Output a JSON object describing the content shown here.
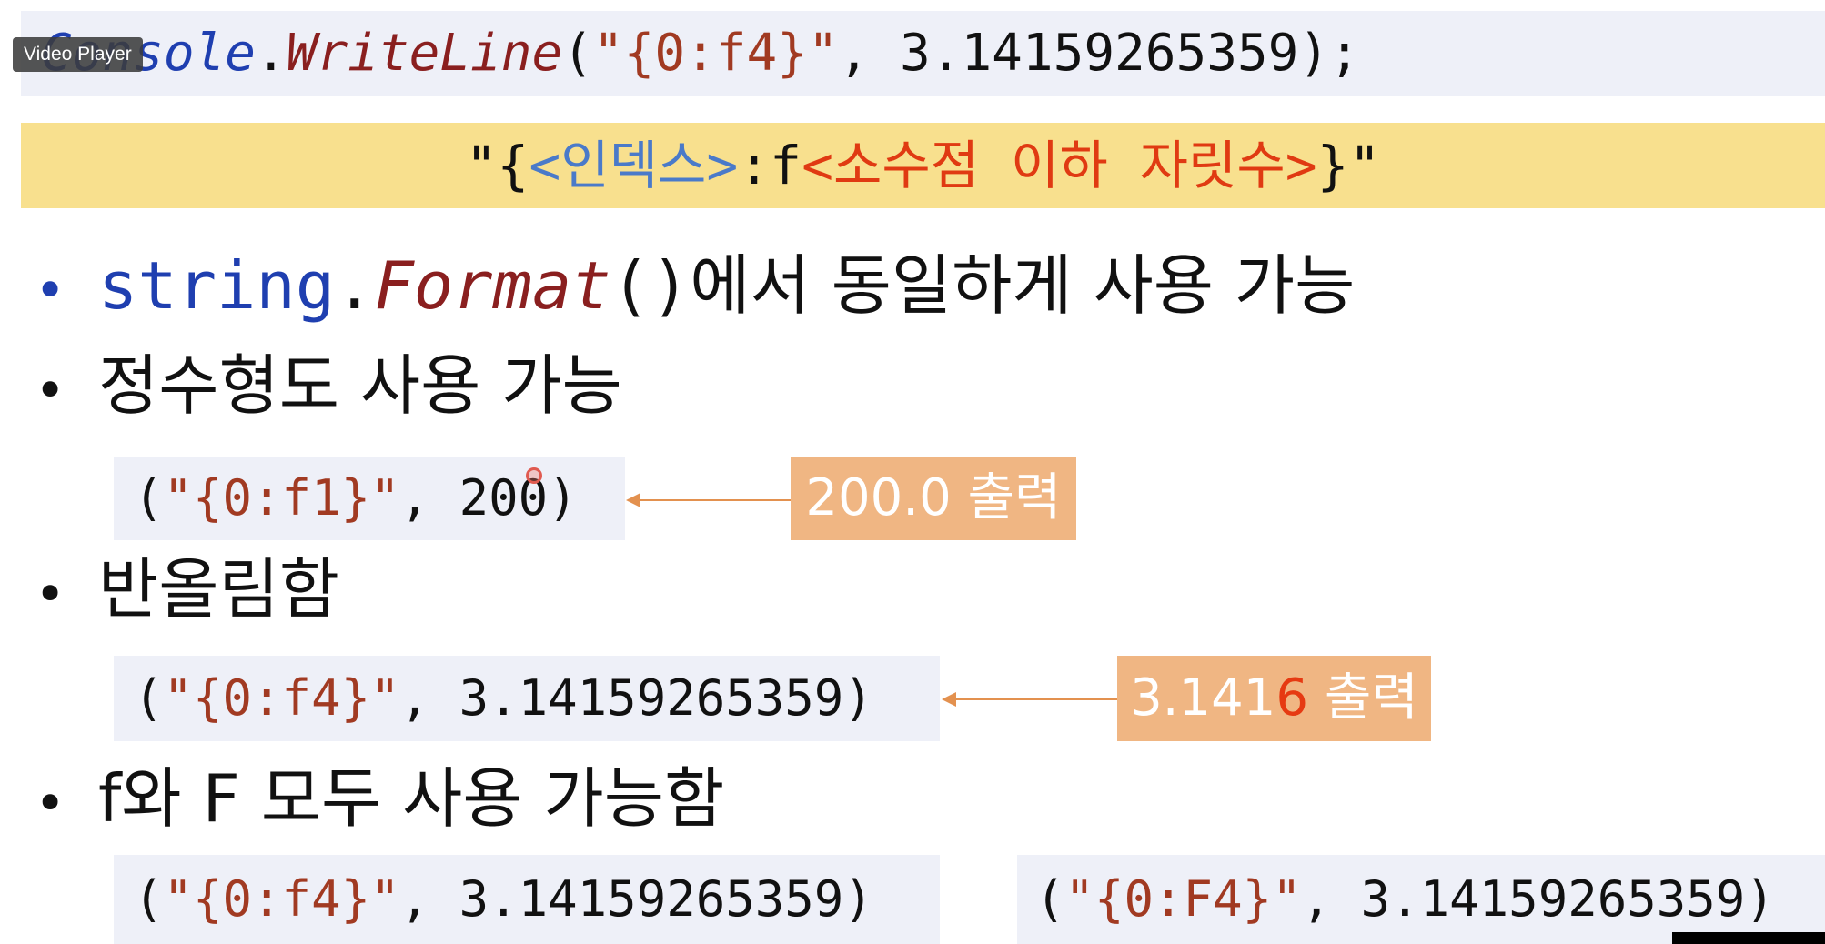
{
  "overlay": {
    "video_label": "Video Player"
  },
  "top_code": {
    "class_name": "Console",
    "dot": ".",
    "method": "WriteLine",
    "open": "(",
    "format": "\"{0:f4}\"",
    "rest": ", 3.14159265359);"
  },
  "banner": {
    "open": "\"{",
    "index": "<인덱스>",
    "colon_f": ":f",
    "digits": "<소수점 이하 자릿수>",
    "close": "}\""
  },
  "bullets": [
    {
      "code_name": "string",
      "dot": ".",
      "method": "Format",
      "parens": "()",
      "text": "에서 동일하게 사용 가능"
    },
    {
      "text": "정수형도 사용 가능"
    },
    {
      "text": "반올림함"
    },
    {
      "text": "f와 F 모두 사용 가능함"
    }
  ],
  "examples": {
    "integer": {
      "open": "(",
      "format": "\"{0:f1}\"",
      "rest": ", 200)"
    },
    "rounding": {
      "open": "(",
      "format": "\"{0:f4}\"",
      "rest": ", 3.14159265359)"
    },
    "lower_f": {
      "open": "(",
      "format": "\"{0:f4}\"",
      "rest": ", 3.14159265359)"
    },
    "upper_f": {
      "open": "(",
      "format": "\"{0:F4}\"",
      "rest": ", 3.14159265359)"
    }
  },
  "callouts": {
    "integer_output": "200.0 출력",
    "rounding_prefix": "3.141",
    "rounding_digit": "6",
    "rounding_suffix": " 출력"
  },
  "colors": {
    "code_bg": "#eef0f8",
    "banner_bg": "#f8e08e",
    "callout_bg": "#f0b683",
    "keyword_blue": "#1f3fb0",
    "method_red": "#8a1f1f",
    "highlight_red": "#e03a12"
  }
}
